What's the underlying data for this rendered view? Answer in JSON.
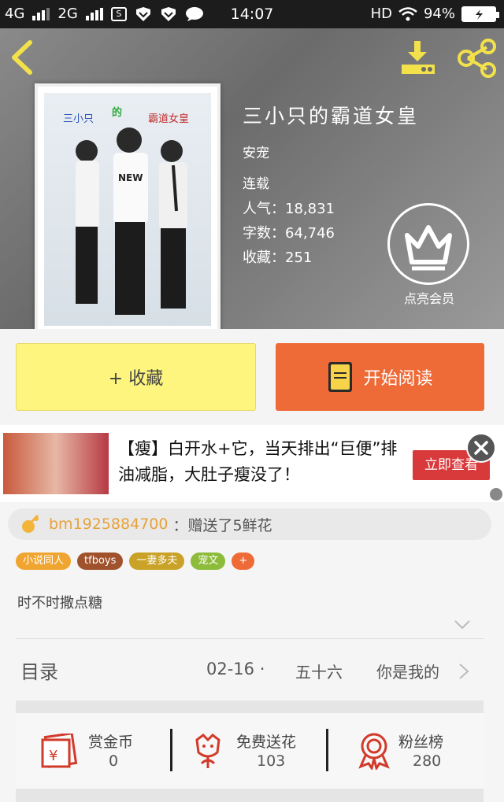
{
  "status_bar": {
    "network_1": "4G",
    "network_2": "2G",
    "time": "14:07",
    "hd": "HD",
    "battery": "94%"
  },
  "header": {
    "back_icon": "chevron-left-icon",
    "download_icon": "download-icon",
    "share_icon": "share-icon"
  },
  "book": {
    "title": "三小只的霸道女皇",
    "author": "安宠",
    "status": "连载",
    "popularity_label": "人气：",
    "popularity": "18,831",
    "words_label": "字数：",
    "words": "64,746",
    "collections_label": "收藏：",
    "collections": "251",
    "cover": {
      "text_left": "三小只",
      "text_middle": "的",
      "text_right": "霸道女皇",
      "shirt_text": "NEW"
    }
  },
  "vip": {
    "icon": "crown-icon",
    "label": "点亮会员"
  },
  "actions": {
    "collect_label": "+ 收藏",
    "read_label": "开始阅读",
    "read_icon": "book-icon"
  },
  "ad": {
    "text": "【瘦】白开水+它，当天排出“巨便”排油减脂，大肚子瘦没了！",
    "cta": "立即查看",
    "close_icon": "close-icon"
  },
  "gift": {
    "icon": "flower-icon",
    "user": "bm1925884700",
    "message": "：赠送了5鲜花"
  },
  "tags": [
    {
      "label": "小说同人",
      "color": "#f0a530"
    },
    {
      "label": "tfboys",
      "color": "#a0522d"
    },
    {
      "label": "一妻多夫",
      "color": "#c9a227"
    },
    {
      "label": "宠文",
      "color": "#8dbb3a"
    },
    {
      "label": "+",
      "color": "#ee6a37"
    }
  ],
  "description": "时不时撒点糖",
  "toc": {
    "label": "目录",
    "date": "02-16",
    "dot": "·",
    "chapter": "五十六",
    "latest": "你是我的"
  },
  "stats": [
    {
      "label": "赏金币",
      "value": "0",
      "icon": "red-envelope-icon"
    },
    {
      "label": "免费送花",
      "value": "103",
      "icon": "flower-icon"
    },
    {
      "label": "粉丝榜",
      "value": "280",
      "icon": "medal-icon"
    }
  ],
  "colors": {
    "accent_orange": "#ee6a37",
    "accent_yellow": "#fdf57e",
    "icon_yellow": "#f2e14a",
    "icon_red": "#d23a2a"
  }
}
